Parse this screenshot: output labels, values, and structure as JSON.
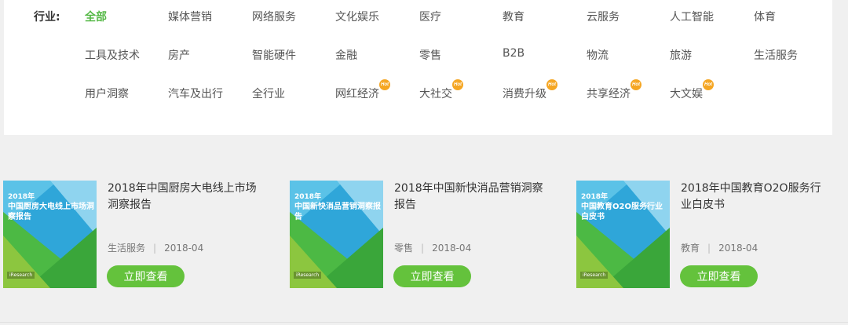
{
  "filter": {
    "label": "行业:",
    "rows": [
      [
        {
          "text": "全部",
          "active": true
        },
        {
          "text": "媒体营销"
        },
        {
          "text": "网络服务"
        },
        {
          "text": "文化娱乐"
        },
        {
          "text": "医疗"
        },
        {
          "text": "教育"
        },
        {
          "text": "云服务"
        },
        {
          "text": "人工智能"
        },
        {
          "text": "体育"
        }
      ],
      [
        {
          "text": "工具及技术"
        },
        {
          "text": "房产"
        },
        {
          "text": "智能硬件"
        },
        {
          "text": "金融"
        },
        {
          "text": "零售"
        },
        {
          "text": "B2B"
        },
        {
          "text": "物流"
        },
        {
          "text": "旅游"
        },
        {
          "text": "生活服务"
        }
      ],
      [
        {
          "text": "用户洞察"
        },
        {
          "text": "汽车及出行"
        },
        {
          "text": "全行业"
        },
        {
          "text": "网红经济",
          "hot": true
        },
        {
          "text": "大社交",
          "hot": true
        },
        {
          "text": "消费升级",
          "hot": true
        },
        {
          "text": "共享经济",
          "hot": true
        },
        {
          "text": "大文娱",
          "hot": true
        }
      ]
    ],
    "hot_badge": "Hot"
  },
  "cards": [
    {
      "thumb_year": "2018年",
      "thumb_title": "中国厨房大电线上市场洞察报告",
      "thumb_brand": "iResearch",
      "title": "2018年中国厨房大电线上市场洞察报告",
      "category": "生活服务",
      "date": "2018-04",
      "button": "立即查看"
    },
    {
      "thumb_year": "2018年",
      "thumb_title": "中国新快消品营销洞察报告",
      "thumb_brand": "iResearch",
      "title": "2018年中国新快消品营销洞察报告",
      "category": "零售",
      "date": "2018-04",
      "button": "立即查看"
    },
    {
      "thumb_year": "2018年",
      "thumb_title": "中国教育O2O服务行业白皮书",
      "thumb_brand": "iResearch",
      "title": "2018年中国教育O2O服务行业白皮书",
      "category": "教育",
      "date": "2018-04",
      "button": "立即查看"
    }
  ],
  "colors": {
    "accent": "#56b947",
    "button": "#64c23c",
    "hot": "#f5a623"
  }
}
